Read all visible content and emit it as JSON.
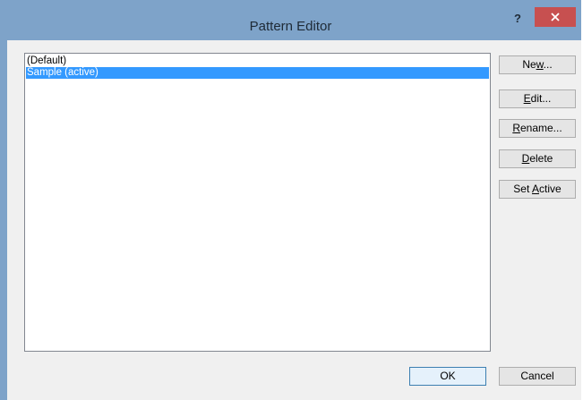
{
  "window": {
    "title": "Pattern Editor",
    "help_label": "?"
  },
  "list": {
    "items": [
      {
        "label": "(Default)",
        "selected": false
      },
      {
        "label": "Sample (active)",
        "selected": true
      }
    ]
  },
  "side_buttons": {
    "new": {
      "pre": "Ne",
      "mnemonic": "w",
      "post": "..."
    },
    "edit": {
      "pre": "",
      "mnemonic": "E",
      "post": "dit..."
    },
    "rename": {
      "pre": "",
      "mnemonic": "R",
      "post": "ename..."
    },
    "delete": {
      "pre": "",
      "mnemonic": "D",
      "post": "elete"
    },
    "set_active": {
      "pre": "Set ",
      "mnemonic": "A",
      "post": "ctive"
    }
  },
  "footer": {
    "ok_label": "OK",
    "cancel_label": "Cancel"
  },
  "colors": {
    "titlebar": "#7ea3c9",
    "close_button": "#c75050",
    "selection": "#3399ff"
  }
}
